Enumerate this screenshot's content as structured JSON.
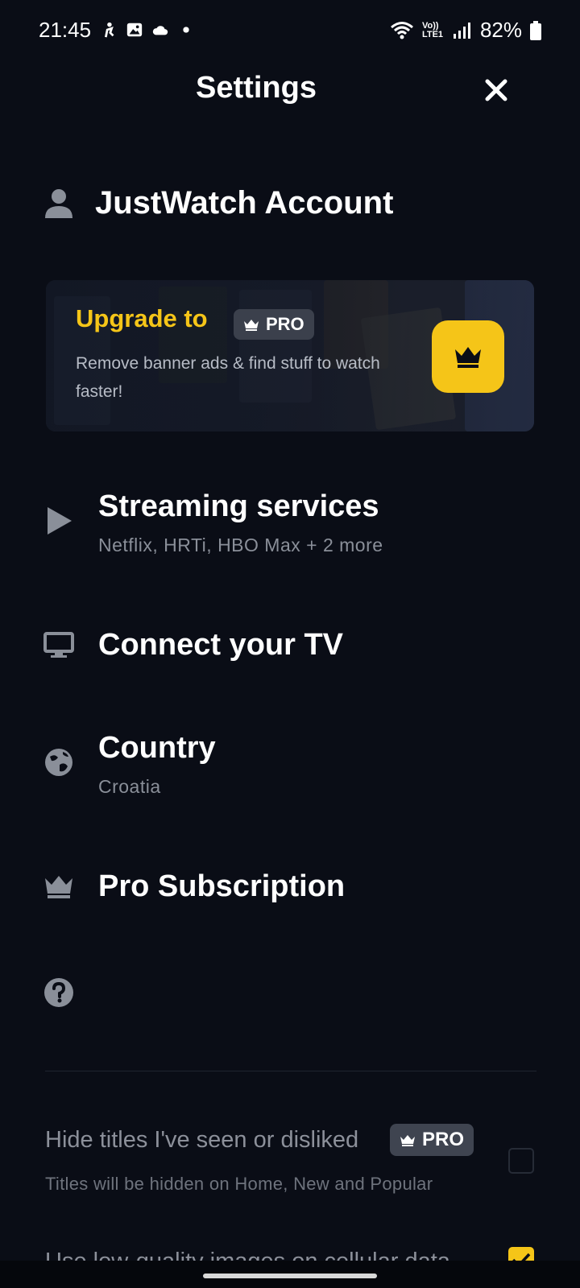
{
  "status_bar": {
    "time": "21:45",
    "battery": "82%",
    "network_label": "Vo)) LTE1"
  },
  "header": {
    "title": "Settings"
  },
  "account": {
    "label": "JustWatch Account"
  },
  "banner": {
    "upgrade_label": "Upgrade to",
    "pro_label": "PRO",
    "description": "Remove banner ads & find stuff to watch faster!"
  },
  "menu": {
    "streaming": {
      "title": "Streaming services",
      "subtitle": "Netflix, HRTi, HBO Max + 2 more"
    },
    "tv": {
      "title": "Connect your TV"
    },
    "country": {
      "title": "Country",
      "subtitle": "Croatia"
    },
    "pro_subscription": {
      "title": "Pro Subscription"
    }
  },
  "preferences": {
    "hide_titles": {
      "label": "Hide titles I've seen or disliked",
      "badge": "PRO",
      "description": "Titles will be hidden on Home, New and Popular",
      "checked": false
    },
    "low_quality": {
      "label": "Use low-quality images on cellular data",
      "checked": true
    }
  },
  "colors": {
    "background": "#0a0d16",
    "accent": "#f5c518",
    "icon_gray": "#8a8f99"
  }
}
